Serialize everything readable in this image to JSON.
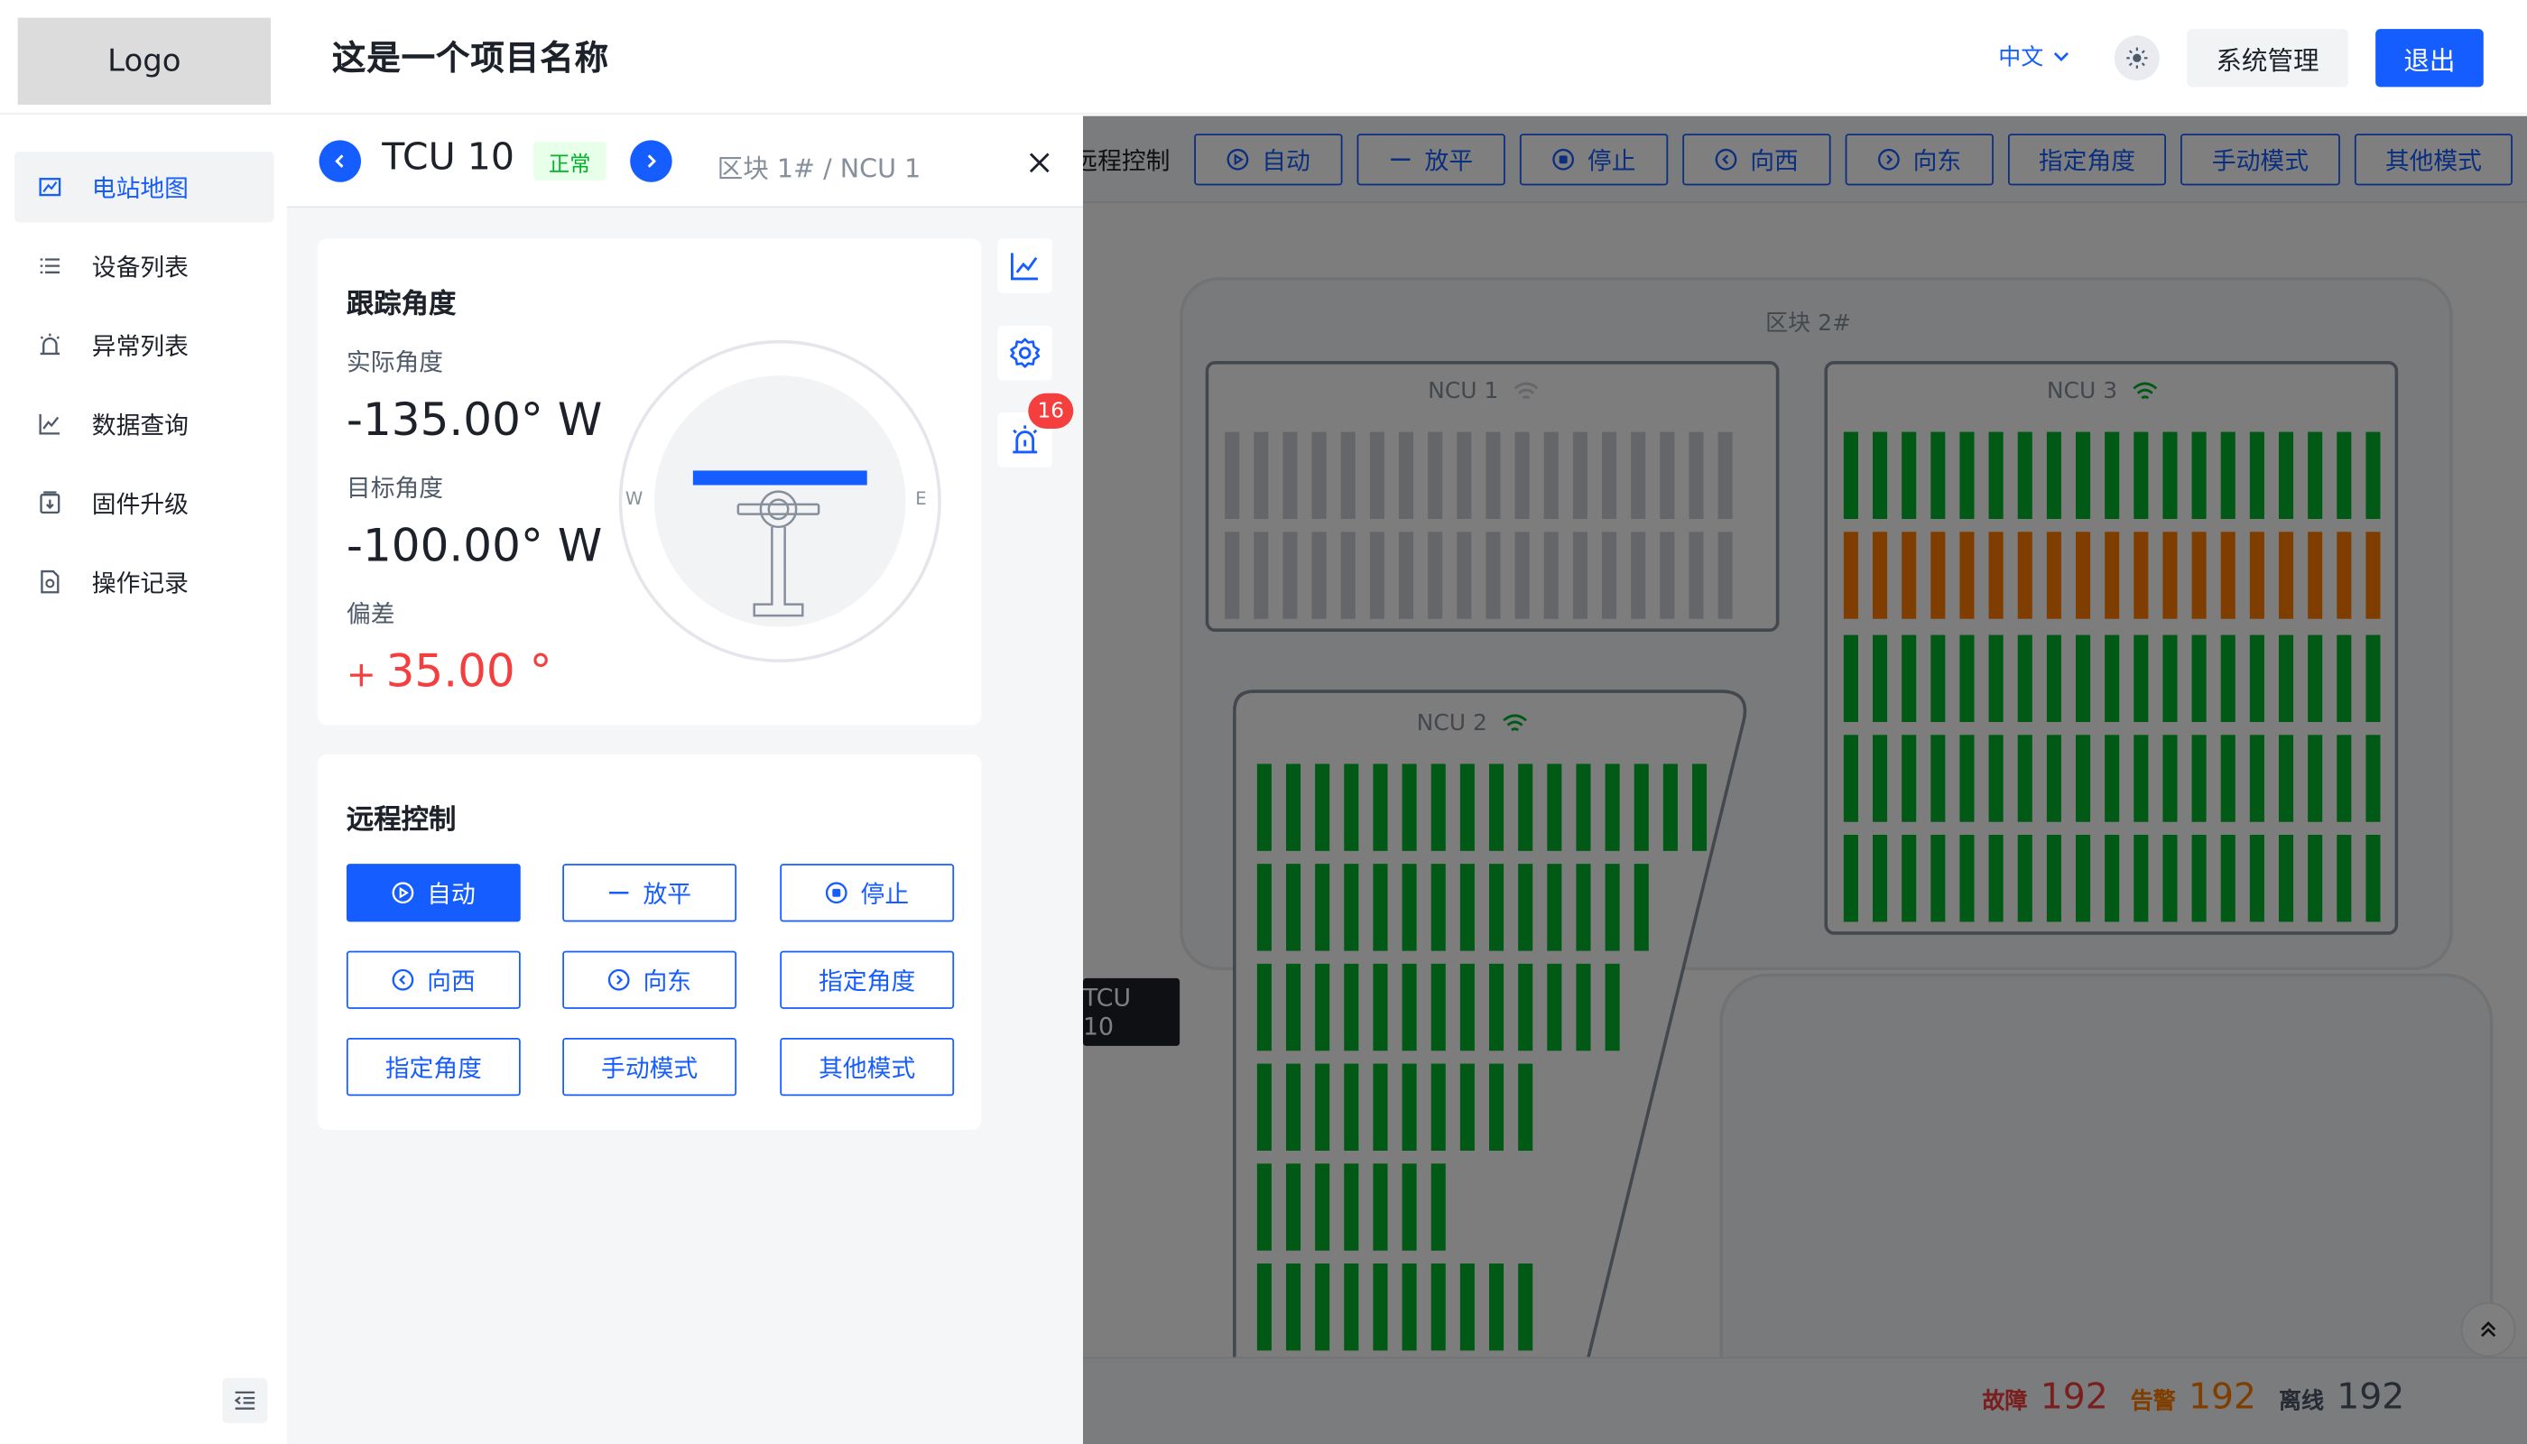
{
  "header": {
    "logo": "Logo",
    "project_name": "这是一个项目名称",
    "language": "中文",
    "system_management": "系统管理",
    "logout": "退出"
  },
  "sidebar": {
    "items": [
      {
        "label": "电站地图",
        "icon": "map-icon",
        "active": true
      },
      {
        "label": "设备列表",
        "icon": "list-icon",
        "active": false
      },
      {
        "label": "异常列表",
        "icon": "alarm-icon",
        "active": false
      },
      {
        "label": "数据查询",
        "icon": "chart-icon",
        "active": false
      },
      {
        "label": "固件升级",
        "icon": "firmware-icon",
        "active": false
      },
      {
        "label": "操作记录",
        "icon": "record-icon",
        "active": false
      }
    ]
  },
  "map": {
    "toolbar_label": "远程控制",
    "toolbar_buttons": [
      "自动",
      "放平",
      "停止",
      "向西",
      "向东",
      "指定角度",
      "手动模式",
      "其他模式"
    ],
    "zone_label": "区块 2#",
    "ncus": [
      {
        "name": "NCU 1",
        "signal": "weak"
      },
      {
        "name": "NCU 3",
        "signal": "strong"
      },
      {
        "name": "NCU 2",
        "signal": "strong"
      }
    ],
    "tcu_tag": "TCU 10",
    "stats": {
      "fault_label": "故障",
      "fault_value": "192",
      "warning_label": "告警",
      "warning_value": "192",
      "offline_label": "离线",
      "offline_value": "192"
    },
    "colors": {
      "normal": "#00b42a",
      "warning": "#ff7d00",
      "offline": "#c9cdd4"
    }
  },
  "panel": {
    "tcu_name": "TCU 10",
    "status": "正常",
    "breadcrumb": "区块 1# / NCU 1",
    "tracking": {
      "title": "跟踪角度",
      "actual_label": "实际角度",
      "actual_value": "-135.00° W",
      "target_label": "目标角度",
      "target_value": "-100.00° W",
      "deviation_label": "偏差",
      "deviation_sign": "+",
      "deviation_value": "35.00 °",
      "dial_west": "W",
      "dial_east": "E"
    },
    "alert_count": "16",
    "remote": {
      "title": "远程控制",
      "buttons": [
        "自动",
        "放平",
        "停止",
        "向西",
        "向东",
        "指定角度",
        "指定角度",
        "手动模式",
        "其他模式"
      ]
    }
  }
}
